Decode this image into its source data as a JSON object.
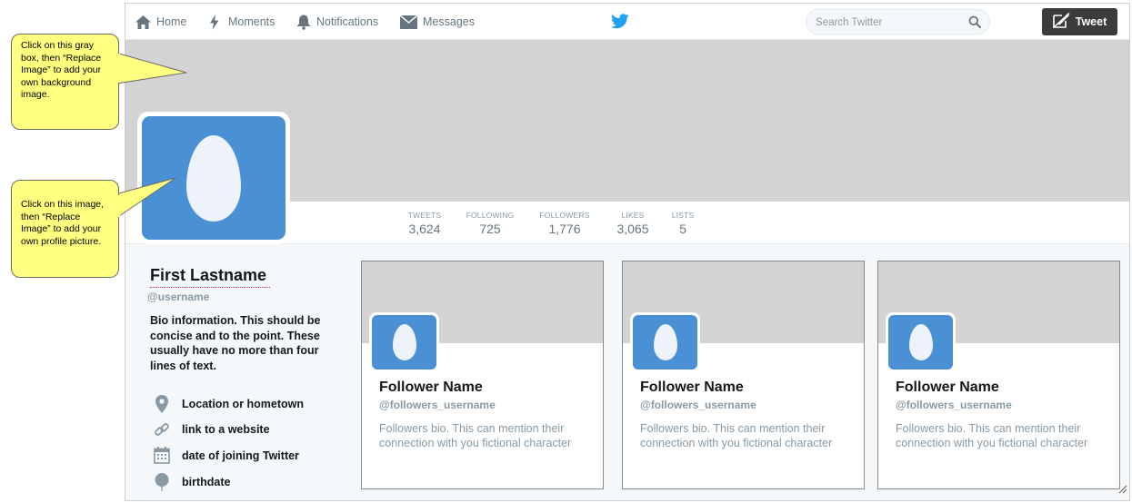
{
  "nav": {
    "home": "Home",
    "moments": "Moments",
    "notifications": "Notifications",
    "messages": "Messages",
    "search_placeholder": "Search Twitter",
    "tweet": "Tweet"
  },
  "stats": [
    {
      "label": "TWEETS",
      "value": "3,624"
    },
    {
      "label": "FOLLOWING",
      "value": "725"
    },
    {
      "label": "FOLLOWERS",
      "value": "1,776"
    },
    {
      "label": "LIKES",
      "value": "3,065"
    },
    {
      "label": "LISTS",
      "value": "5"
    }
  ],
  "profile": {
    "name": "First Lastname",
    "username": "@username",
    "bio": "Bio information. This should be concise and to the point. These usually have no more than four lines of text.",
    "location": "Location or hometown",
    "website": "link to a website",
    "joined": "date of joining Twitter",
    "birthdate": "birthdate"
  },
  "followers": [
    {
      "name": "Follower Name",
      "username": "@followers_username",
      "bio": "Followers bio. This can mention their connection with you fictional character"
    },
    {
      "name": "Follower Name",
      "username": "@followers_username",
      "bio": "Followers bio. This can mention their connection with you fictional character"
    },
    {
      "name": "Follower Name",
      "username": "@followers_username",
      "bio": "Followers bio. This can mention their connection with you fictional character"
    }
  ],
  "callouts": {
    "background": "Click on this gray box, then “Replace Image” to add your own background image.",
    "profile": "Click on this image, then “Replace Image” to add your own profile picture."
  },
  "colors": {
    "accent": "#1da1f2",
    "avatar": "#4a90d4",
    "header": "#d3d3d3",
    "callout": "#ffff80"
  }
}
